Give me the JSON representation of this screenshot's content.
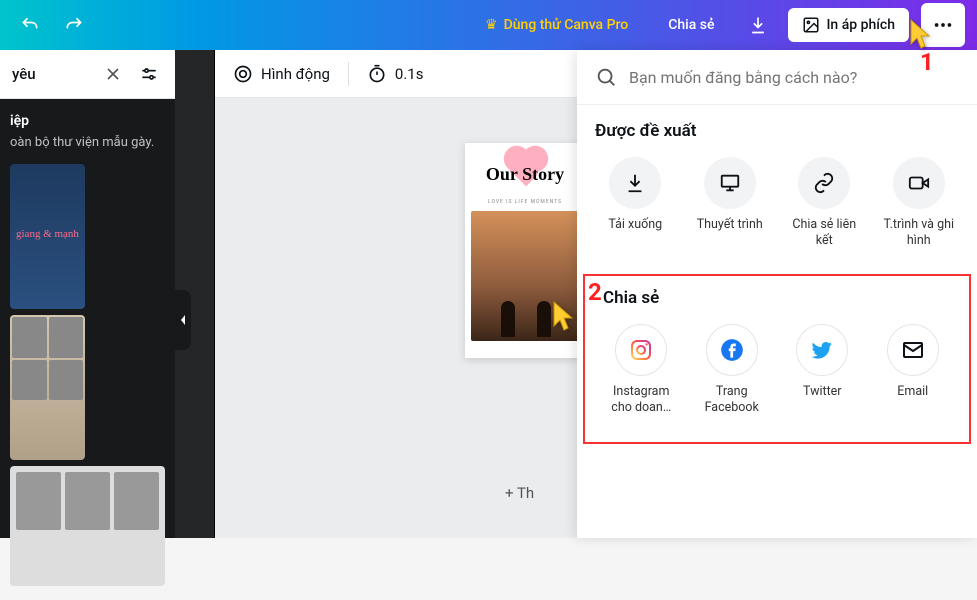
{
  "header": {
    "pro_label": "Dùng thử Canva Pro",
    "share_label": "Chia sẻ",
    "print_label": "In áp phích"
  },
  "sidebar": {
    "tab_title": "yêu",
    "heading": "iệp",
    "description": "oàn bộ thư viện mẫu gày.",
    "tpl1_text": "giang & mạnh"
  },
  "toolbar": {
    "animate_label": "Hình động",
    "duration_label": "0.1s"
  },
  "poster": {
    "title": "Our Story",
    "subtitle": "LOVE IS LIFE MOMENTS"
  },
  "canvas": {
    "add_button": "+ Th"
  },
  "share_panel": {
    "search_placeholder": "Bạn muốn đăng bằng cách nào?",
    "suggested_title": "Được đề xuất",
    "suggested": [
      {
        "label": "Tải xuống"
      },
      {
        "label": "Thuyết trình"
      },
      {
        "label": "Chia sẻ liên kết"
      },
      {
        "label": "T.trình và ghi hình"
      }
    ],
    "share_title": "Chia sẻ",
    "share_items": [
      {
        "label": "Instagram cho doan…"
      },
      {
        "label": "Trang Facebook"
      },
      {
        "label": "Twitter"
      },
      {
        "label": "Email"
      }
    ]
  },
  "annotations": {
    "one": "1",
    "two": "2"
  }
}
